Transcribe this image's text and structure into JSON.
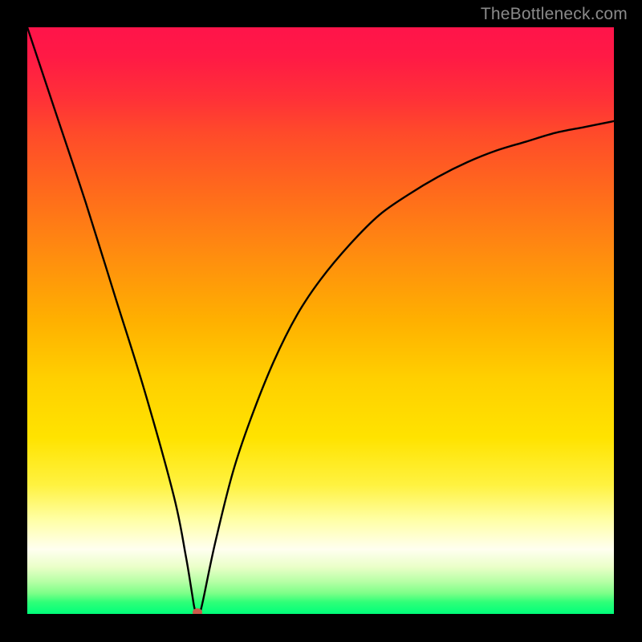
{
  "watermark": {
    "text": "TheBottleneck.com"
  },
  "colors": {
    "curve_stroke": "#000000",
    "marker_fill": "#cc5a4b",
    "frame_bg": "#000000"
  },
  "chart_data": {
    "type": "line",
    "title": "",
    "xlabel": "",
    "ylabel": "",
    "xlim": [
      0,
      100
    ],
    "ylim": [
      0,
      100
    ],
    "grid": false,
    "legend": false,
    "marker": {
      "x": 29,
      "y": 0
    },
    "series": [
      {
        "name": "bottleneck-curve",
        "x": [
          0,
          5,
          10,
          15,
          20,
          25,
          27,
          28,
          28.5,
          29,
          29.5,
          30,
          32,
          35,
          38,
          42,
          46,
          50,
          55,
          60,
          65,
          70,
          75,
          80,
          85,
          90,
          95,
          100
        ],
        "y": [
          100,
          85,
          70,
          54,
          38,
          20,
          10,
          4,
          1,
          0,
          0.5,
          2.5,
          12,
          24,
          33,
          43,
          51,
          57,
          63,
          68,
          71.5,
          74.5,
          77,
          79,
          80.5,
          82,
          83,
          84
        ]
      }
    ]
  }
}
